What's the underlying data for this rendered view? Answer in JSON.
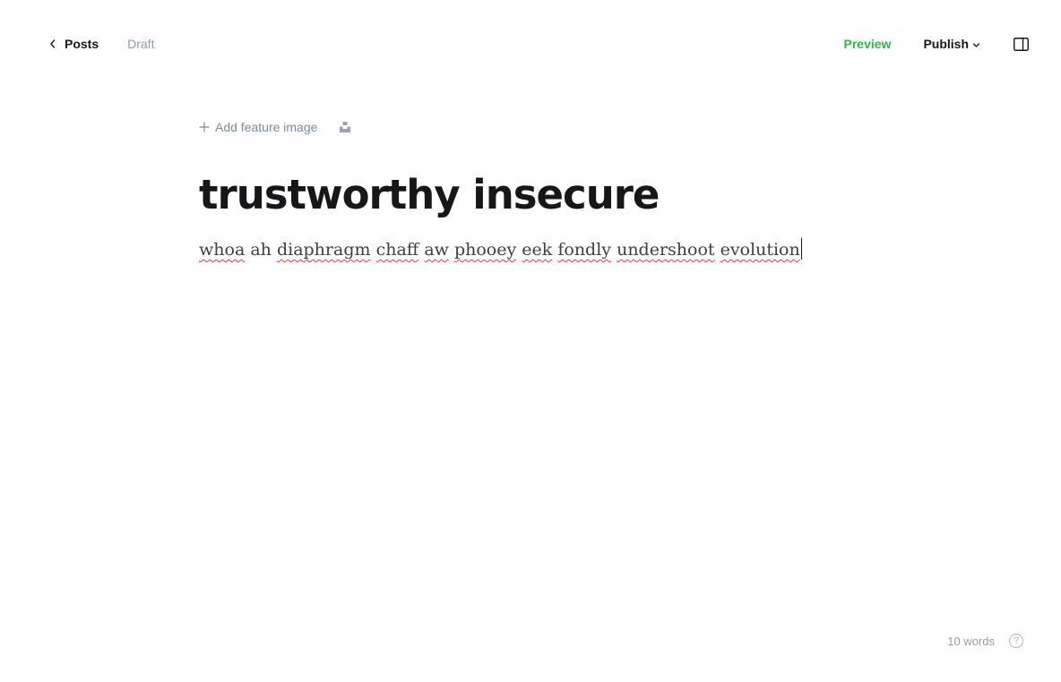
{
  "header": {
    "back_label": "Posts",
    "status": "Draft",
    "preview_label": "Preview",
    "publish_label": "Publish"
  },
  "feature_image": {
    "add_label": "Add feature image"
  },
  "post": {
    "title": "trustworthy insecure",
    "body_words": [
      "whoa",
      "ah",
      "diaphragm",
      "chaff",
      "aw",
      "phooey",
      "eek",
      "fondly",
      "undershoot",
      "evolution"
    ]
  },
  "footer": {
    "word_count": "10 words",
    "help_label": "?"
  },
  "colors": {
    "accent": "#30cf43",
    "text": "#15171a",
    "muted": "#8e9cac",
    "spellcheck": "#e53935"
  },
  "icons": {
    "back": "chevron-left-icon",
    "publish_caret": "chevron-down-icon",
    "sidebar": "sidebar-toggle-icon",
    "add": "plus-icon",
    "unsplash": "unsplash-icon",
    "help": "help-icon"
  }
}
